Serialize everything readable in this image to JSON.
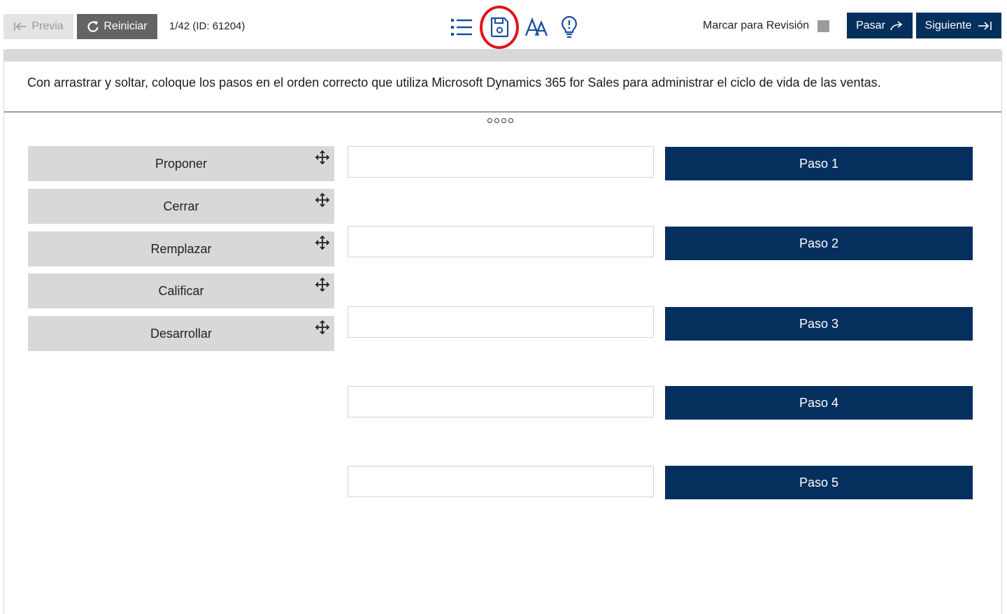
{
  "toolbar": {
    "prev_label": "Previa",
    "reset_label": "Reiniciar",
    "counter": "1/42 (ID: 61204)",
    "icons": [
      "list-icon",
      "save-icon",
      "font-size-icon",
      "hint-bulb-icon"
    ],
    "mark_review_label": "Marcar para Revisión",
    "mark_review_checked": false,
    "skip_label": "Pasar",
    "next_label": "Siguiente",
    "accent_color": "#05305e",
    "highlight_color": "#e0141b"
  },
  "question": {
    "text": "Con arrastrar y soltar, coloque los pasos en el orden correcto que utiliza Microsoft Dynamics 365 for Sales para administrar el ciclo de vida de las ventas."
  },
  "drag_items": [
    {
      "label": "Proponer"
    },
    {
      "label": "Cerrar"
    },
    {
      "label": "Remplazar"
    },
    {
      "label": "Calificar"
    },
    {
      "label": "Desarrollar"
    }
  ],
  "drop_zones": [
    {
      "value": ""
    },
    {
      "value": ""
    },
    {
      "value": ""
    },
    {
      "value": ""
    },
    {
      "value": ""
    }
  ],
  "steps": [
    {
      "label": "Paso 1"
    },
    {
      "label": "Paso 2"
    },
    {
      "label": "Paso 3"
    },
    {
      "label": "Paso 4"
    },
    {
      "label": "Paso 5"
    }
  ]
}
